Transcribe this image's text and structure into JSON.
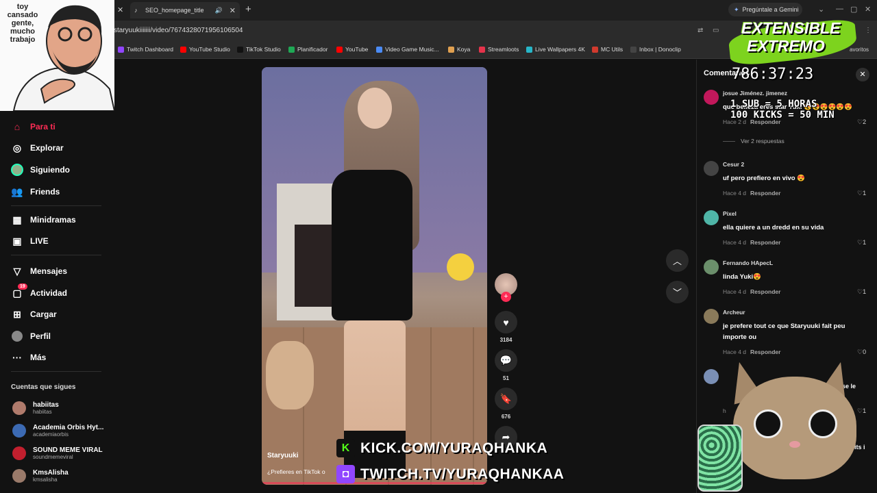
{
  "browser": {
    "tab_title": "SEO_homepage_title",
    "gemini_label": "Pregúntale a Gemini",
    "url": "staryuukiiiiiii/video/7674328071956106504",
    "bookmarks": [
      {
        "label": "Twitch Dashboard",
        "color": "#9146ff"
      },
      {
        "label": "YouTube Studio",
        "color": "#ff0000"
      },
      {
        "label": "TikTok Studio",
        "color": "#111111"
      },
      {
        "label": "Planificador",
        "color": "#1fa855"
      },
      {
        "label": "YouTube",
        "color": "#ff0000"
      },
      {
        "label": "Video Game Music...",
        "color": "#4b8bf5"
      },
      {
        "label": "Koya",
        "color": "#e0a050"
      },
      {
        "label": "Streamloots",
        "color": "#e5334b"
      },
      {
        "label": "Live Wallpapers 4K",
        "color": "#27b6c8"
      },
      {
        "label": "MC Utils",
        "color": "#d13a2e"
      },
      {
        "label": "Inbox | Donoclip",
        "color": "#444444"
      }
    ],
    "bookmarks_overflow": "avoritos"
  },
  "sidebar": {
    "nav": [
      {
        "label": "Para ti",
        "icon": "home-icon",
        "active": true
      },
      {
        "label": "Explorar",
        "icon": "compass-icon"
      },
      {
        "label": "Siguiendo",
        "icon": "following-avatar-icon"
      },
      {
        "label": "Friends",
        "icon": "friends-icon"
      },
      {
        "label": "Minidramas",
        "icon": "minidramas-icon"
      },
      {
        "label": "LIVE",
        "icon": "live-icon"
      },
      {
        "label": "Mensajes",
        "icon": "send-icon"
      },
      {
        "label": "Actividad",
        "icon": "activity-icon",
        "badge": "19"
      },
      {
        "label": "Cargar",
        "icon": "upload-icon"
      },
      {
        "label": "Perfil",
        "icon": "profile-avatar-icon"
      },
      {
        "label": "Más",
        "icon": "more-icon"
      }
    ],
    "following_title": "Cuentas que sigues",
    "accounts": [
      {
        "name": "habiitas",
        "handle": "habiitas",
        "color": "#b07b6c"
      },
      {
        "name": "Academia Orbis Hyt...",
        "handle": "academiaorbis",
        "color": "#3c6ab3"
      },
      {
        "name": "SOUND MEME VIRAL",
        "handle": "soundmemeviral",
        "color": "#c21f2e"
      },
      {
        "name": "KmsAlisha",
        "handle": "kmsalisha",
        "color": "#9a7a6a"
      }
    ]
  },
  "meme": {
    "text": "toy cansado gente, mucho trabajo"
  },
  "video": {
    "author": "Staryuuki",
    "description": "¿Prefieres en TikTok o",
    "likes": "3184",
    "comments": "51",
    "saves": "676"
  },
  "comments": {
    "title": "Comentarios",
    "reply_label": "Responder",
    "items": [
      {
        "user": "josue Jiménez. jimenez",
        "text": "que belleza eres star Yuki 😍😍😍😍😍😍",
        "time": "Hace 2 d",
        "likes": "2",
        "avatar": "#c2185b"
      },
      {
        "user": "Cesur 2",
        "text": "uf pero prefiero en vivo 😍",
        "time": "Hace 4 d",
        "likes": "1",
        "avatar": "#444444"
      },
      {
        "user": "Pixel",
        "text": "ella quiere a un dredd en su vida",
        "time": "Hace 4 d",
        "likes": "1",
        "avatar": "#4fb5a7"
      },
      {
        "user": "Fernando HApecL",
        "text": "linda Yuki😍",
        "time": "Hace 4 d",
        "likes": "1",
        "avatar": "#6b8f6b"
      },
      {
        "user": "Archeur",
        "text": "je prefere tout ce que Staryuuki fait peu importe ou",
        "time": "Hace 4 d",
        "likes": "0",
        "avatar": "#8a7a5a"
      }
    ],
    "view_replies": "Ver 2 respuestas",
    "partial_text": ", se le",
    "partial_initial": "h",
    "partial_likes": "1"
  },
  "overlay": {
    "logo_line1": "EXTENSIBLE",
    "logo_line2": "EXTREMO",
    "timer": "786:37:23",
    "sub_line1": "1 SUB = 5 HORAS",
    "sub_line2": "100 KICKS = 50 MIN",
    "kick_url": "KICK.COM/YURAQHANKA",
    "twitch_url": "TWITCH.TV/YURAQHANKAA",
    "bits_text": "0 bits i",
    "kick_color": "#53fc18",
    "twitch_color": "#9146ff"
  }
}
